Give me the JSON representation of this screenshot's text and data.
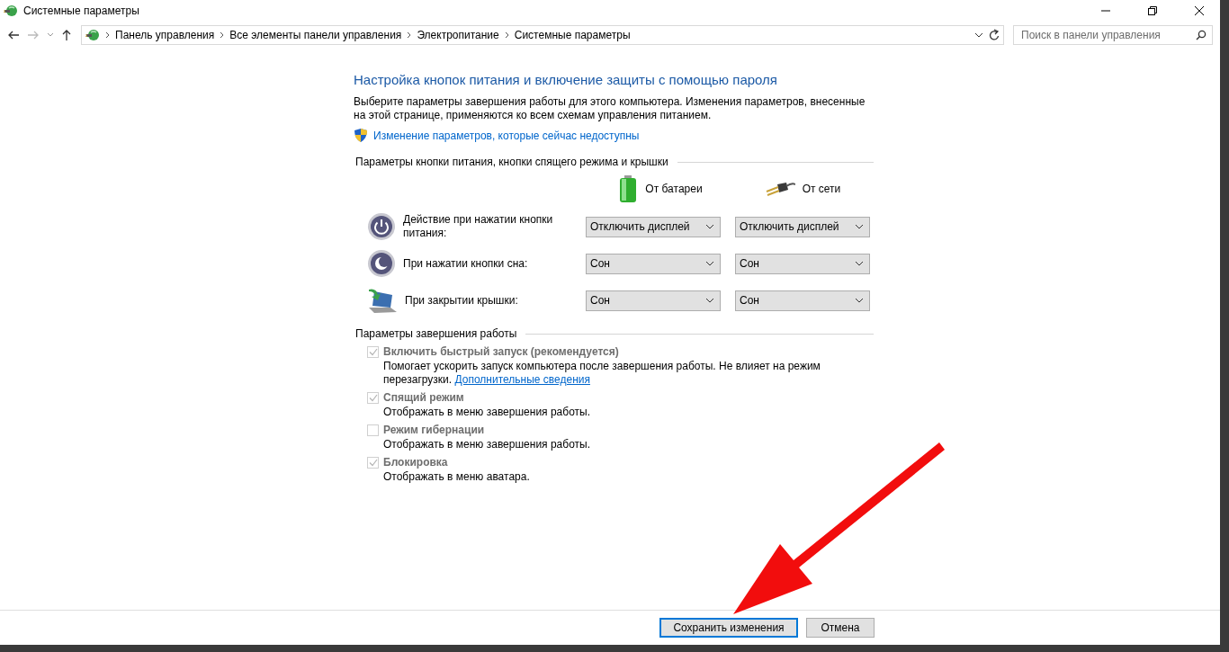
{
  "window": {
    "title": "Системные параметры"
  },
  "address_bar": {
    "breadcrumbs": [
      "Панель управления",
      "Все элементы панели управления",
      "Электропитание",
      "Системные параметры"
    ]
  },
  "search": {
    "placeholder": "Поиск в панели управления"
  },
  "heading": "Настройка кнопок питания и включение защиты с помощью пароля",
  "description": "Выберите параметры завершения работы для этого компьютера. Изменения параметров, внесенные на этой странице, применяются ко всем схемам управления питанием.",
  "admin_link": "Изменение параметров, которые сейчас недоступны",
  "power_section": {
    "title": "Параметры кнопки питания, кнопки спящего режима и крышки",
    "columns": [
      {
        "kind": "battery",
        "label": "От батареи"
      },
      {
        "kind": "plug",
        "label": "От сети"
      }
    ],
    "rows": [
      {
        "kind": "power",
        "label": "Действие при нажатии кнопки питания:",
        "values": [
          "Отключить дисплей",
          "Отключить дисплей"
        ]
      },
      {
        "kind": "sleep",
        "label": "При нажатии кнопки сна:",
        "values": [
          "Сон",
          "Сон"
        ]
      },
      {
        "kind": "lid",
        "label": "При закрытии крышки:",
        "values": [
          "Сон",
          "Сон"
        ]
      }
    ]
  },
  "shutdown_section": {
    "title": "Параметры завершения работы",
    "options": [
      {
        "label": "Включить быстрый запуск (рекомендуется)",
        "checked": true,
        "disabled": true,
        "description": "Помогает ускорить запуск компьютера после завершения работы. Не влияет на режим перезагрузки.",
        "link": "Дополнительные сведения"
      },
      {
        "label": "Спящий режим",
        "checked": true,
        "disabled": true,
        "description": "Отображать в меню завершения работы."
      },
      {
        "label": "Режим гибернации",
        "checked": false,
        "disabled": true,
        "description": "Отображать в меню завершения работы."
      },
      {
        "label": "Блокировка",
        "checked": true,
        "disabled": true,
        "description": "Отображать в меню аватара."
      }
    ]
  },
  "buttons": [
    {
      "label": "Сохранить изменения",
      "focused": true
    },
    {
      "label": "Отмена",
      "focused": false
    }
  ]
}
